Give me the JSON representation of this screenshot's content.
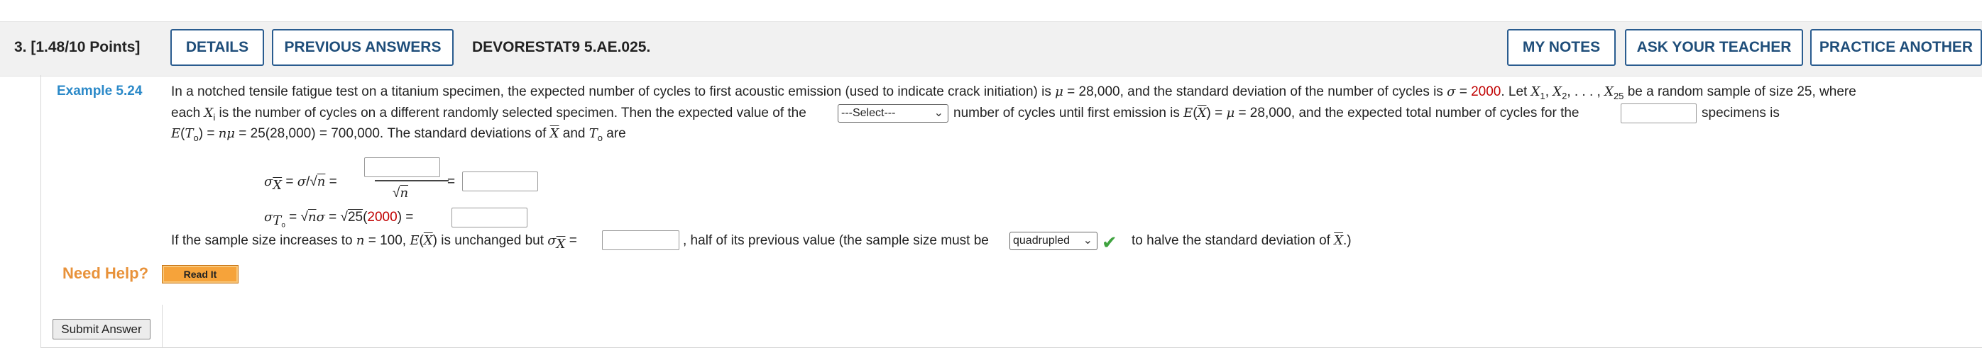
{
  "header": {
    "question_number": "3.",
    "points": "[1.48/10 Points]",
    "details_label": "DETAILS",
    "previous_answers_label": "PREVIOUS ANSWERS",
    "problem_code": "DEVORESTAT9 5.AE.025.",
    "my_notes_label": "MY NOTES",
    "ask_teacher_label": "ASK YOUR TEACHER",
    "practice_another_label": "PRACTICE ANOTHER"
  },
  "problem": {
    "example_label": "Example 5.24",
    "line1": "In a notched tensile fatigue test on a titanium specimen, the expected number of cycles to first acoustic emission (used to indicate crack initiation) is",
    "mu": "μ",
    "mean_value": "= 28,000, and the standard deviation of the number of cycles is",
    "sigma": "σ",
    "eq": "=",
    "sd_value": "2000",
    "let_text": ". Let",
    "sample_text": "be a random sample of size 25, where",
    "line2a": "each",
    "line2b": "is the number of cycles on a different randomly selected specimen. Then the expected value of the",
    "select1_value": "---Select---",
    "line2c": "number of cycles until first emission is",
    "line2d": "= 28,000, and the expected total number of cycles for the",
    "line2e": "specimens is",
    "line3a": "= 25(28,000) = 700,000. The standard deviations of",
    "line3b": "and",
    "line3c": "are",
    "sqrt_25": "25",
    "const_2000": "2000",
    "line_n100a": "If the sample size increases to",
    "line_n100b": "= 100,",
    "line_n100c": "is unchanged but",
    "line_n100d": ", half of its previous value (the sample size must be",
    "select2_value": "quadrupled",
    "line_n100e": "to halve the standard deviation of"
  },
  "help": {
    "need_help_label": "Need Help?",
    "read_it_label": "Read It"
  },
  "footer": {
    "submit_label": "Submit Answer"
  },
  "icons": {
    "check": "check-icon",
    "chevron": "chevron-down-icon"
  },
  "colors": {
    "accent_blue": "#2b89c8",
    "button_border": "#2a5c8f",
    "value_red": "#c00000",
    "help_orange": "#e8923a",
    "check_green": "#3fa33f"
  }
}
